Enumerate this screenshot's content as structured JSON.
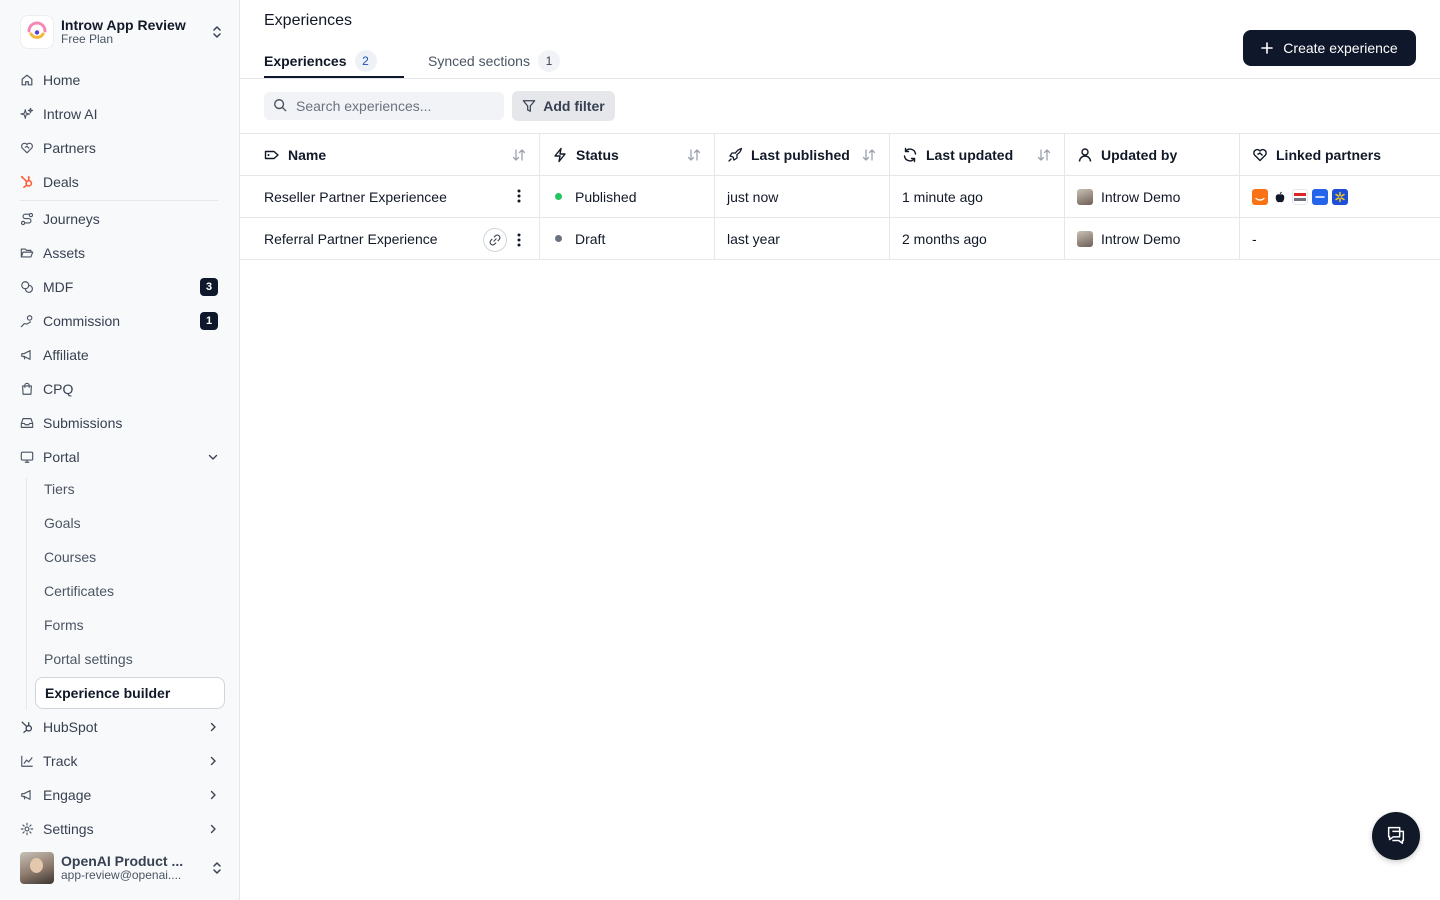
{
  "org": {
    "name": "Introw App Review",
    "plan": "Free Plan"
  },
  "nav": {
    "home": "Home",
    "ai": "Introw AI",
    "partners": "Partners",
    "deals": "Deals",
    "journeys": "Journeys",
    "assets": "Assets",
    "mdf": "MDF",
    "mdf_count": "3",
    "commission": "Commission",
    "commission_count": "1",
    "affiliate": "Affiliate",
    "cpq": "CPQ",
    "submissions": "Submissions",
    "portal": "Portal",
    "portal_sub": [
      "Tiers",
      "Goals",
      "Courses",
      "Certificates",
      "Forms",
      "Portal settings",
      "Experience builder"
    ],
    "hubspot": "HubSpot",
    "track": "Track",
    "engage": "Engage",
    "settings": "Settings"
  },
  "user": {
    "name": "OpenAI Product ...",
    "email": "app-review@openai...."
  },
  "page": {
    "title": "Experiences"
  },
  "tabs": [
    {
      "label": "Experiences",
      "count": "2"
    },
    {
      "label": "Synced sections",
      "count": "1"
    }
  ],
  "create_label": "Create experience",
  "search": {
    "placeholder": "Search experiences..."
  },
  "filter_label": "Add filter",
  "table": {
    "columns": [
      "Name",
      "Status",
      "Last published",
      "Last updated",
      "Updated by",
      "Linked partners"
    ],
    "rows": [
      {
        "name": "Reseller Partner Experiencee",
        "status": "Published",
        "last_published": "just now",
        "last_updated": "1 minute ago",
        "updated_by": "Introw Demo",
        "linked": ""
      },
      {
        "name": "Referral Partner Experience",
        "status": "Draft",
        "last_published": "last year",
        "last_updated": "2 months ago",
        "updated_by": "Introw Demo",
        "linked": "-"
      }
    ]
  },
  "colors": {
    "primary": "#0f172a",
    "published": "#22c55e",
    "draft": "#6b7280",
    "hubspot": "#ff5c35"
  }
}
